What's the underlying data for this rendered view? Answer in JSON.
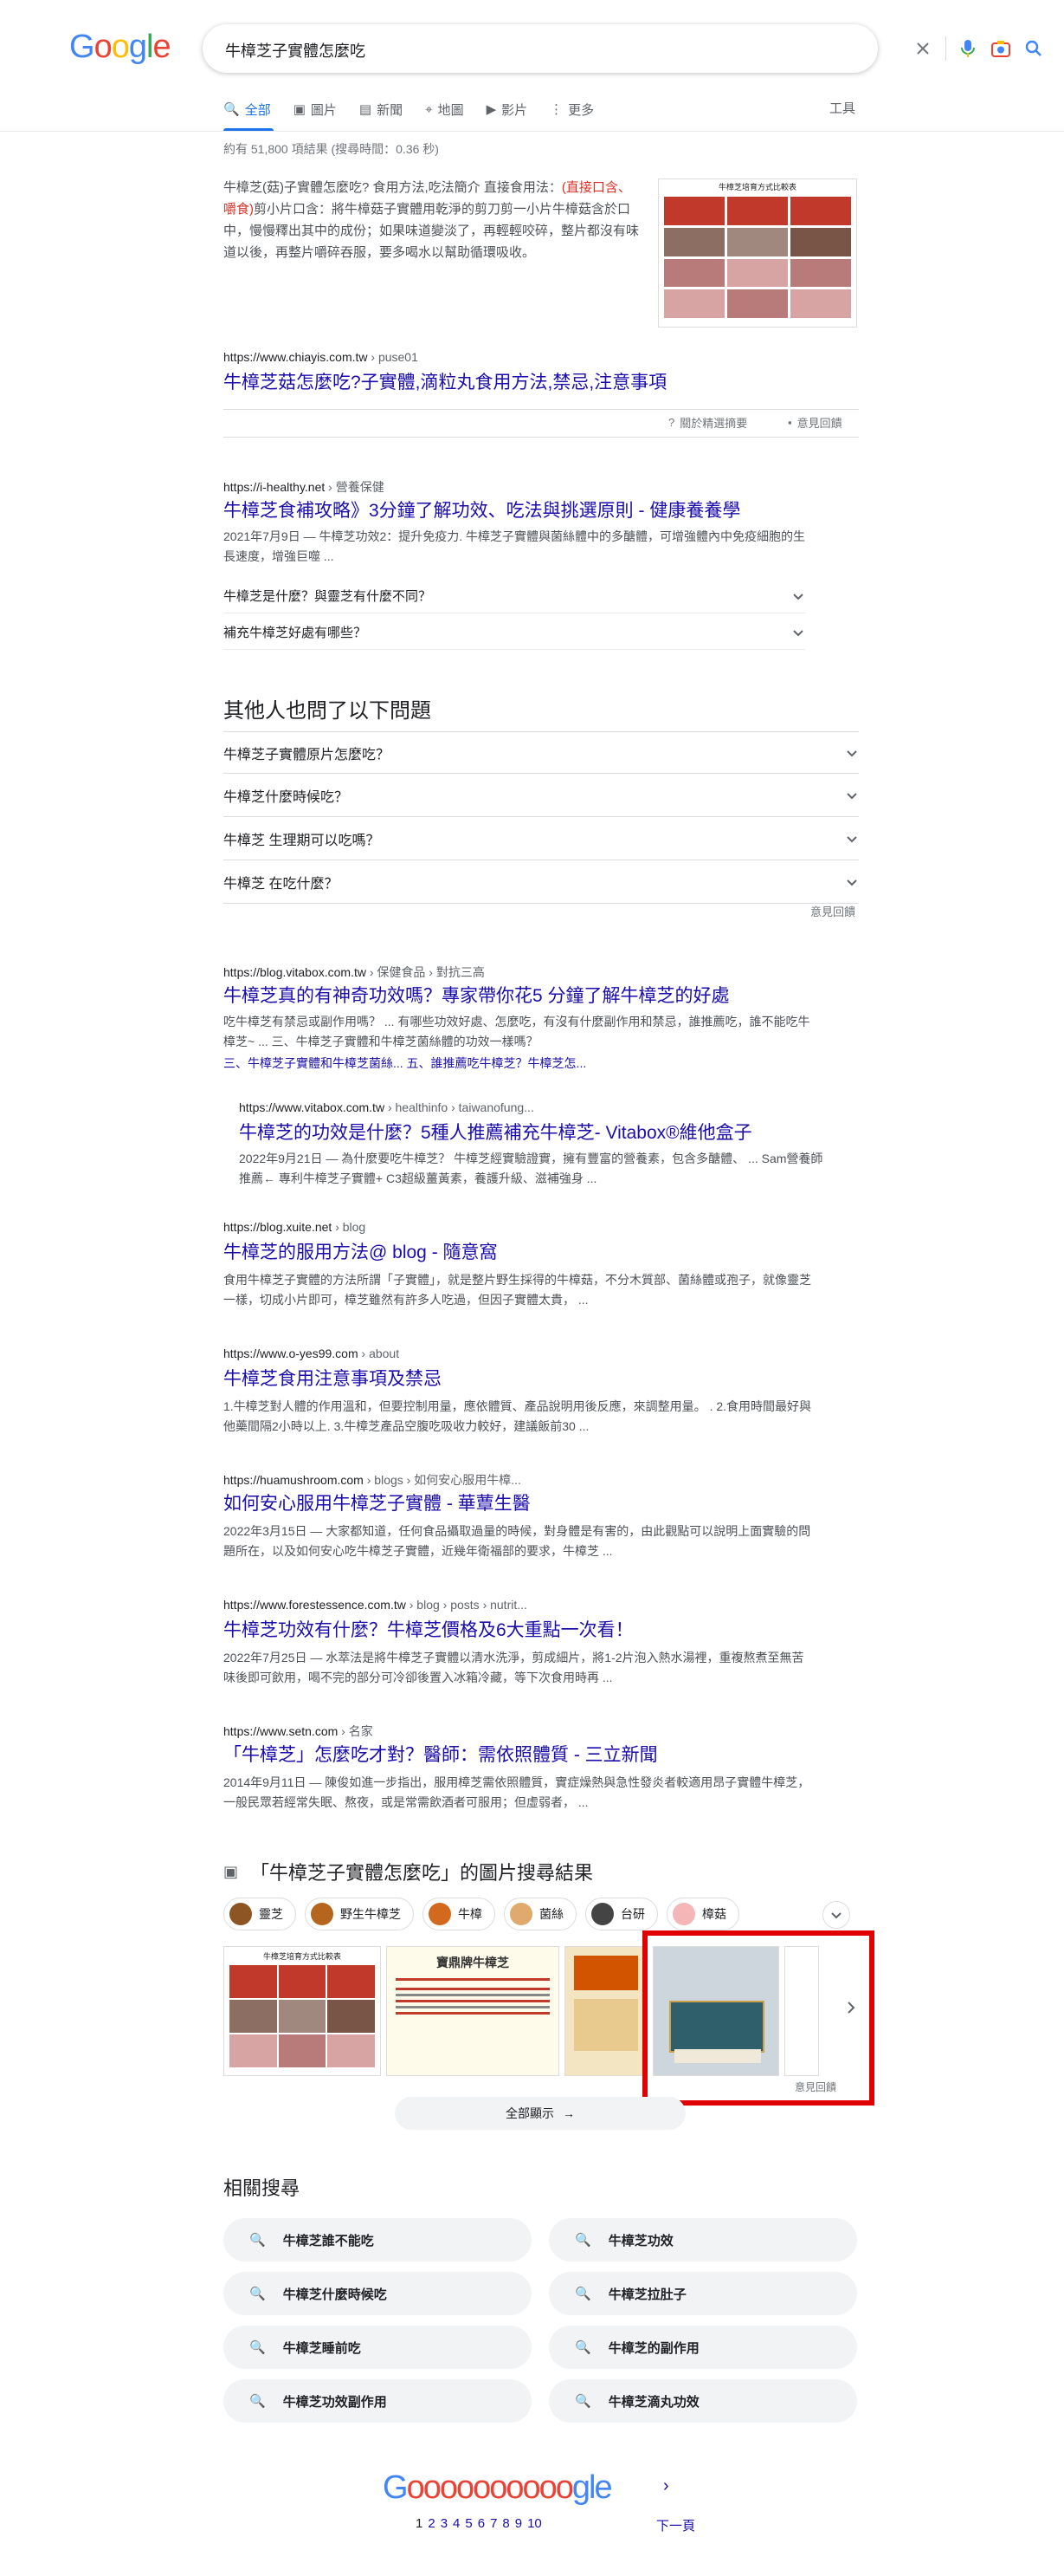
{
  "search": {
    "query": "牛樟芝子實體怎麼吃",
    "logo": [
      "G",
      "o",
      "o",
      "g",
      "l",
      "e"
    ]
  },
  "tabs": [
    {
      "label": "全部",
      "icon": "search-icon"
    },
    {
      "label": "圖片",
      "icon": "image-icon"
    },
    {
      "label": "新聞",
      "icon": "news-icon"
    },
    {
      "label": "地圖",
      "icon": "map-pin-icon"
    },
    {
      "label": "影片",
      "icon": "video-icon"
    },
    {
      "label": "更多",
      "icon": "more-vert-icon"
    }
  ],
  "tools_label": "工具",
  "stats": "約有 51,800 項結果 (搜尋時間：0.36 秒)",
  "featured": {
    "text_a": "牛樟芝(菇)子實體怎麼吃? 食用方法,吃法簡介 直接食用法：",
    "text_em": "(直接口含、嚼食)",
    "text_b": "剪小片口含：將牛樟菇子實體用乾淨的剪刀剪一小片牛樟菇含於口中，慢慢釋出其中的成份；如果味道變淡了，再輕輕咬碎，整片都沒有味道以後，再整片嚼碎吞服，要多喝水以幫助循環吸收。",
    "image_title": "牛樟芝培育方式比較表",
    "url": "https://www.chiayis.com.tw",
    "crumb": " › puse01",
    "title": "牛樟芝菇怎麼吃?子實體,滴粒丸食用方法,禁忌,注意事項",
    "about": "關於精選摘要",
    "feedback": "意見回饋"
  },
  "results": [
    {
      "url": "https://i-healthy.net",
      "crumb": " › 營養保健",
      "title": "牛樟芝食補攻略》3分鐘了解功效、吃法與挑選原則 - 健康養養學",
      "desc": "2021年7月9日 — 牛樟芝功效2：提升免疫力. 牛樟芝子實體與菌絲體中的多醣體，可增強體內中免疫細胞的生長速度，增強巨噬 ..."
    },
    {
      "url": "https://blog.vitabox.com.tw",
      "crumb": " › 保健食品 › 對抗三高",
      "title": "牛樟芝真的有神奇功效嗎？專家帶你花5 分鐘了解牛樟芝的好處",
      "desc": "吃牛樟芝有禁忌或副作用嗎？ ... 有哪些功效好處、怎麼吃，有沒有什麼副作用和禁忌，誰推薦吃，誰不能吃牛樟芝~ ... 三、牛樟芝子實體和牛樟芝菌絲體的功效一樣嗎？"
    },
    {
      "url": "https://www.vitabox.com.tw",
      "crumb": " › healthinfo › taiwanofung...",
      "title": "牛樟芝的功效是什麼？5種人推薦補充牛樟芝- Vitabox®維他盒子",
      "desc": "2022年9月21日 — 為什麼要吃牛樟芝？ 牛樟芝經實驗證實，擁有豐富的營養素，包含多醣體、 ... Sam營養師推薦← 專利牛樟芝子實體+ C3超級薑黃素，養護升級、滋補強身 ..."
    },
    {
      "url": "https://blog.xuite.net",
      "crumb": " › blog",
      "title": "牛樟芝的服用方法@ blog - 隨意窩",
      "desc": "食用牛樟芝子實體的方法所謂「子實體」，就是整片野生採得的牛樟菇，不分木質部、菌絲體或孢子，就像靈芝一樣，切成小片即可，樟芝雖然有許多人吃過，但因子實體太貴， ..."
    },
    {
      "url": "https://www.o-yes99.com",
      "crumb": " › about",
      "title": "牛樟芝食用注意事項及禁忌",
      "desc": "1.牛樟芝對人體的作用溫和，但要控制用量，應依體質、產品說明用後反應，來調整用量。 . 2.食用時間最好與他藥間隔2小時以上. 3.牛樟芝產品空腹吃吸收力較好，建議飯前30 ..."
    },
    {
      "url": "https://huamushroom.com",
      "crumb": " › blogs › 如何安心服用牛樟...",
      "title": "如何安心服用牛樟芝子實體 - 華蕈生醫",
      "desc": "2022年3月15日 — 大家都知道，任何食品攝取過量的時候，對身體是有害的，由此觀點可以說明上面實驗的問題所在，以及如何安心吃牛樟芝子實體，近幾年衛福部的要求，牛樟芝 ..."
    },
    {
      "url": "https://www.forestessence.com.tw",
      "crumb": " › blog › posts › nutrit...",
      "title": "牛樟芝功效有什麼？牛樟芝價格及6大重點一次看！",
      "desc": "2022年7月25日 — 水萃法是將牛樟芝子實體以清水洗淨，剪成細片，將1-2片泡入熱水湯裡，重複熬煮至無苦味後即可飲用，喝不完的部分可冷卻後置入冰箱冷藏，等下次食用時再 ..."
    },
    {
      "url": "https://www.setn.com",
      "crumb": " › 名家",
      "title": "「牛樟芝」怎麼吃才對？醫師：需依照體質 - 三立新聞",
      "desc": "2014年9月11日 — 陳俊如進一步指出，服用樟芝需依照體質，實症燥熱與急性發炎者較適用昂子實體牛樟芝，一般民眾若經常失眠、熬夜，或是常需飲酒者可服用；但虛弱者， ..."
    }
  ],
  "sub_questions": [
    "牛樟芝是什麼？與靈芝有什麼不同？",
    "補充牛樟芝好處有哪些？"
  ],
  "sitelinks": "三、牛樟芝子實體和牛樟芝菌絲... 五、誰推薦吃牛樟芝？牛樟芝怎...",
  "paa": {
    "heading": "其他人也問了以下問題",
    "questions": [
      "牛樟芝子實體原片怎麼吃？",
      "牛樟芝什麼時候吃？",
      "牛樟芝 生理期可以吃嗎？",
      "牛樟芝 在吃什麼？"
    ],
    "feedback": "意見回饋"
  },
  "images": {
    "heading": "「牛樟芝子實體怎麼吃」的圖片搜尋結果",
    "chips": [
      "靈芝",
      "野生牛樟芝",
      "牛樟",
      "菌絲",
      "台研",
      "樟菇"
    ],
    "card1_title": "牛樟芝培育方式比較表",
    "card2_title": "寶鼎牌牛樟芝",
    "feedback": "意見回饋",
    "show_all": "全部顯示"
  },
  "related": {
    "heading": "相關搜尋",
    "items": [
      "牛樟芝誰不能吃",
      "牛樟芝功效",
      "牛樟芝什麼時候吃",
      "牛樟芝拉肚子",
      "牛樟芝睡前吃",
      "牛樟芝的副作用",
      "牛樟芝功效副作用",
      "牛樟芝滴丸功效"
    ]
  },
  "pager": {
    "logo_g": "G",
    "logo_os": "oooooooooo",
    "logo_gle": "gle",
    "pages": [
      "1",
      "2",
      "3",
      "4",
      "5",
      "6",
      "7",
      "8",
      "9",
      "10"
    ],
    "next": "下一頁"
  },
  "colors": {
    "link": "#1a0dab",
    "accent": "#1a73e8",
    "highlight_border": "#e00000",
    "em": "#d93025"
  }
}
